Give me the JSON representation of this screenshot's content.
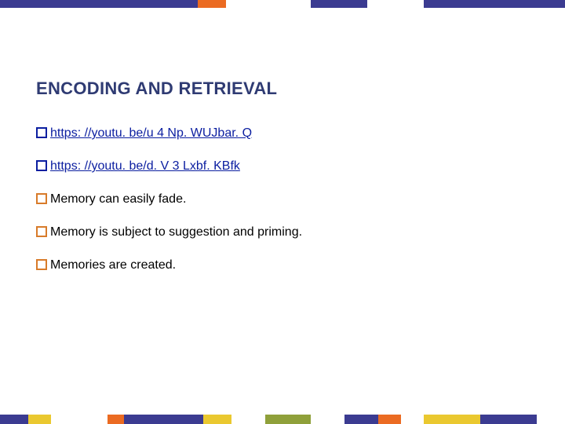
{
  "title": "ENCODING AND RETRIEVAL",
  "bullets": [
    {
      "text": "https: //youtu. be/u 4 Np. WUJbar. Q",
      "is_link": true
    },
    {
      "text": "https: //youtu. be/d. V 3 Lxbf. KBfk",
      "is_link": true
    },
    {
      "text": "Memory can easily fade.",
      "is_link": false
    },
    {
      "text": "Memory is subject to suggestion and priming.",
      "is_link": false
    },
    {
      "text": "Memories are created.",
      "is_link": false
    }
  ],
  "colors": {
    "bullet_link": "#0b1ea0",
    "bullet_text": "#d87b2a",
    "title": "#2f3b73"
  },
  "top_bar": [
    {
      "c": "#3b3b91",
      "w": 35
    },
    {
      "c": "#eb6b22",
      "w": 5
    },
    {
      "c": "#ffffff",
      "w": 15
    },
    {
      "c": "#3b3b91",
      "w": 10
    },
    {
      "c": "#ffffff",
      "w": 10
    },
    {
      "c": "#3b3b91",
      "w": 25
    }
  ],
  "bottom_bar": [
    {
      "c": "#3b3b91",
      "w": 5
    },
    {
      "c": "#eac82f",
      "w": 4
    },
    {
      "c": "#ffffff",
      "w": 10
    },
    {
      "c": "#eb6b22",
      "w": 3
    },
    {
      "c": "#3b3b91",
      "w": 14
    },
    {
      "c": "#eac82f",
      "w": 5
    },
    {
      "c": "#ffffff",
      "w": 6
    },
    {
      "c": "#8fa03a",
      "w": 8
    },
    {
      "c": "#ffffff",
      "w": 6
    },
    {
      "c": "#3b3b91",
      "w": 6
    },
    {
      "c": "#eb6b22",
      "w": 4
    },
    {
      "c": "#ffffff",
      "w": 4
    },
    {
      "c": "#eac82f",
      "w": 10
    },
    {
      "c": "#3b3b91",
      "w": 10
    },
    {
      "c": "#ffffff",
      "w": 5
    }
  ]
}
